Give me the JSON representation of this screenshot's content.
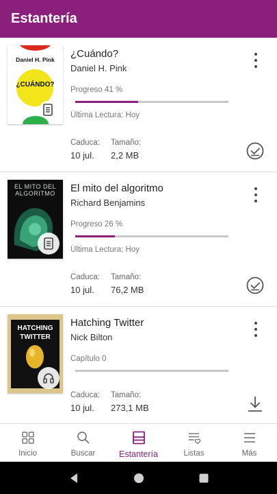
{
  "header": {
    "title": "Estantería"
  },
  "books": [
    {
      "title": "¿Cuándo?",
      "author": "Daniel H. Pink",
      "status_label": "Progreso 41 %",
      "progress": 0.41,
      "last_read": "Última Lectura: Hoy",
      "expires_label": "Caduca:",
      "expires_value": "10 jul.",
      "size_label": "Tamaño:",
      "size_value": "2,2 MB",
      "format_icon": "ebook-icon",
      "action_icon": "check-circle-icon",
      "cover": {
        "author_text": "Daniel H. Pink",
        "title_text": "¿CUÁNDO?"
      }
    },
    {
      "title": "El mito del algoritmo",
      "author": "Richard Benjamins",
      "status_label": "Progreso 26 %",
      "progress": 0.26,
      "last_read": "Última Lectura: Hoy",
      "expires_label": "Caduca:",
      "expires_value": "10 jul.",
      "size_label": "Tamaño:",
      "size_value": "76,2 MB",
      "format_icon": "ebook-icon",
      "action_icon": "check-circle-icon",
      "cover": {
        "title_text": "EL MITO DEL ALGORITMO"
      }
    },
    {
      "title": "Hatching Twitter",
      "author": "Nick Bilton",
      "status_label": "Capítulo 0",
      "progress": 0,
      "last_read": "",
      "expires_label": "Caduca:",
      "expires_value": "10 jul.",
      "size_label": "Tamaño:",
      "size_value": "273,1 MB",
      "format_icon": "headphones-icon",
      "action_icon": "download-icon",
      "cover": {
        "title_text": "HATCHING TWITTER"
      }
    }
  ],
  "tabs": [
    {
      "label": "Inicio",
      "icon": "grid-icon"
    },
    {
      "label": "Buscar",
      "icon": "search-icon"
    },
    {
      "label": "Estantería",
      "icon": "shelf-icon",
      "active": true
    },
    {
      "label": "Listas",
      "icon": "list-heart-icon"
    },
    {
      "label": "Más",
      "icon": "hamburger-icon"
    }
  ],
  "colors": {
    "accent": "#8b1f7c",
    "track": "#c8c8c8"
  }
}
